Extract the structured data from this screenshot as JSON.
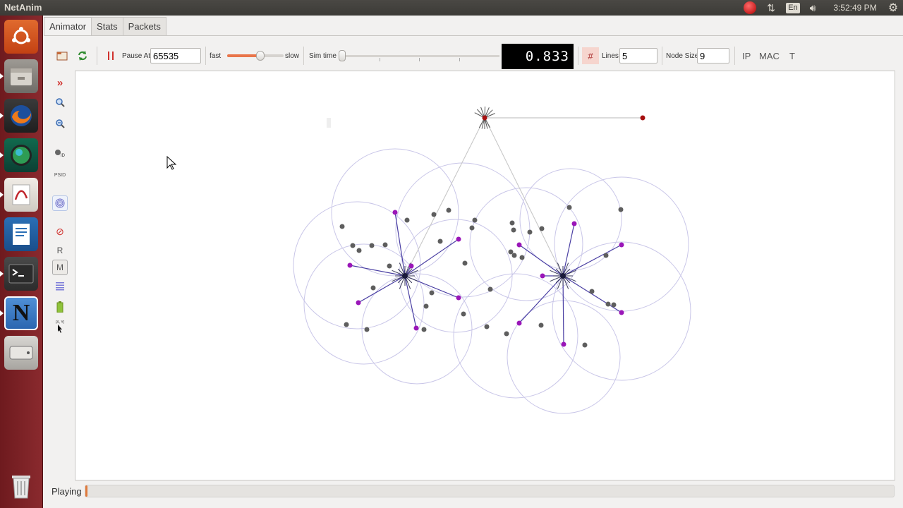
{
  "topbar": {
    "app_title": "NetAnim",
    "keyboard_layout": "En",
    "clock": "3:52:49 PM"
  },
  "launcher": {
    "items": [
      "ubuntu-dash",
      "files",
      "firefox",
      "app-globe",
      "document-viewer",
      "libreoffice-writer",
      "terminal",
      "netanim",
      "drive",
      "trash"
    ]
  },
  "tabs": [
    "Animator",
    "Stats",
    "Packets"
  ],
  "active_tab": "Animator",
  "toolbar": {
    "pause_at_label": "Pause At",
    "pause_at_value": "65535",
    "fast_label": "fast",
    "slow_label": "slow",
    "speed_fraction": 0.6,
    "sim_time_label": "Sim time",
    "sim_time_fraction": 0.0,
    "time_display": "0.833",
    "lines_label": "Lines",
    "lines_value": "5",
    "node_size_label": "Node Size",
    "node_size_value": "9",
    "ip_label": "IP",
    "mac_label": "MAC",
    "t_label": "T"
  },
  "side_tools": {
    "r_label": "R",
    "m_label": "M",
    "xy_label": "(X, Y)",
    "psid_label": "PSID"
  },
  "status": {
    "label": "Playing",
    "progress_fraction": 0.002
  },
  "colors": {
    "wired_node": "#a60f0f",
    "ap_link": "#4a3fa3",
    "station_node": "#9a16b8",
    "other_node": "#5e5e5e",
    "range_circle": "#c9c6e8",
    "launcher_bg": "#7a2024"
  }
}
